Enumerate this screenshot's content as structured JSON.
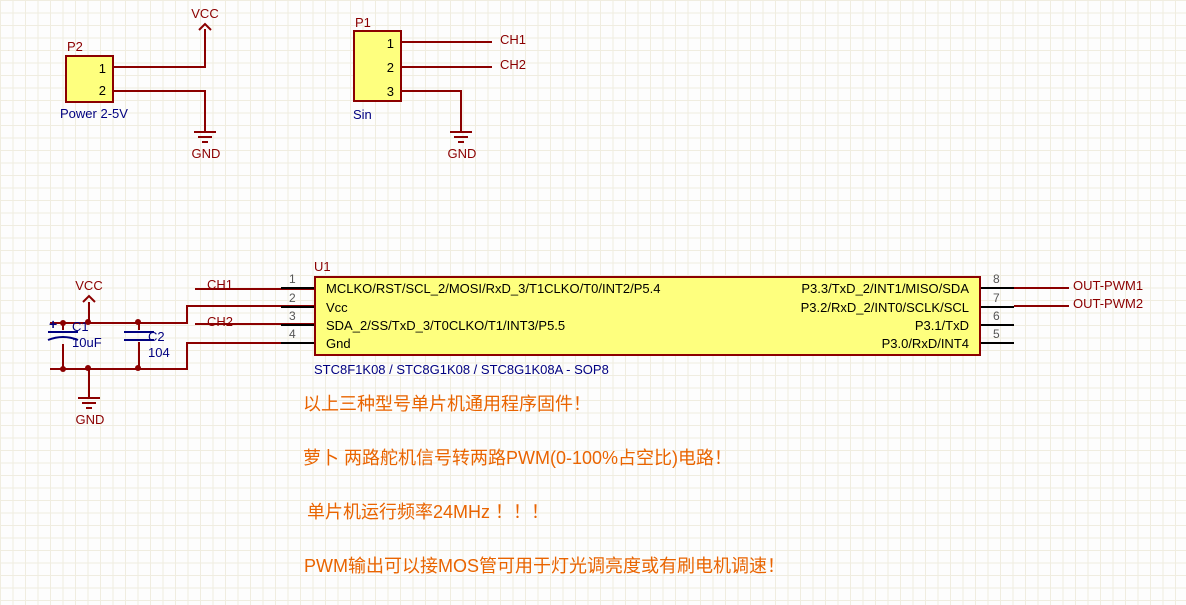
{
  "pwr": {
    "vcc": "VCC",
    "gnd": "GND"
  },
  "P2": {
    "ref": "P2",
    "pins": [
      "1",
      "2"
    ],
    "desc": "Power 2-5V"
  },
  "P1": {
    "ref": "P1",
    "pins": [
      "1",
      "2",
      "3"
    ],
    "desc": "Sin"
  },
  "nets": {
    "ch1": "CH1",
    "ch2": "CH2",
    "out1": "OUT-PWM1",
    "out2": "OUT-PWM2",
    "vcc_side": "VCC",
    "gnd_side": "GND"
  },
  "C1": {
    "ref": "C1",
    "val": "10uF"
  },
  "C2": {
    "ref": "C2",
    "val": "104"
  },
  "U1": {
    "ref": "U1",
    "left": {
      "1": "MCLKO/RST/SCL_2/MOSI/RxD_3/T1CLKO/T0/INT2/P5.4",
      "2": "Vcc",
      "3": "SDA_2/SS/TxD_3/T0CLKO/T1/INT3/P5.5",
      "4": "Gnd"
    },
    "right": {
      "8": "P3.3/TxD_2/INT1/MISO/SDA",
      "7": "P3.2/RxD_2/INT0/SCLK/SCL",
      "6": "P3.1/TxD",
      "5": "P3.0/RxD/INT4"
    },
    "part": "STC8F1K08 / STC8G1K08 / STC8G1K08A - SOP8"
  },
  "notes": [
    "以上三种型号单片机通用程序固件！",
    "萝卜 两路舵机信号转两路PWM(0-100%占空比)电路！",
    "单片机运行频率24MHz ！！！",
    "PWM输出可以接MOS管可用于灯光调亮度或有刷电机调速！"
  ],
  "chart_data": {
    "type": "schematic",
    "connectors": [
      {
        "ref": "P2",
        "pins": 2,
        "function": "Power 2-5V",
        "nets": {
          "1": "VCC",
          "2": "GND"
        }
      },
      {
        "ref": "P1",
        "pins": 3,
        "function": "Sin",
        "nets": {
          "1": "CH1",
          "2": "CH2",
          "3": "GND"
        }
      }
    ],
    "passives": [
      {
        "ref": "C1",
        "value": "10uF",
        "type": "polarized-capacitor",
        "nets": [
          "VCC",
          "GND"
        ]
      },
      {
        "ref": "C2",
        "value": "104",
        "type": "capacitor",
        "nets": [
          "VCC",
          "GND"
        ]
      }
    ],
    "ic": {
      "ref": "U1",
      "package": "SOP8",
      "compatible": [
        "STC8F1K08",
        "STC8G1K08",
        "STC8G1K08A"
      ],
      "pins": {
        "1": {
          "name": "MCLKO/RST/SCL_2/MOSI/RxD_3/T1CLKO/T0/INT2/P5.4",
          "net": "CH1"
        },
        "2": {
          "name": "Vcc",
          "net": "VCC"
        },
        "3": {
          "name": "SDA_2/SS/TxD_3/T0CLKO/T1/INT3/P5.5",
          "net": "CH2"
        },
        "4": {
          "name": "Gnd",
          "net": "GND"
        },
        "5": {
          "name": "P3.0/RxD/INT4",
          "net": ""
        },
        "6": {
          "name": "P3.1/TxD",
          "net": ""
        },
        "7": {
          "name": "P3.2/RxD_2/INT0/SCLK/SCL",
          "net": "OUT-PWM2"
        },
        "8": {
          "name": "P3.3/TxD_2/INT1/MISO/SDA",
          "net": "OUT-PWM1"
        }
      }
    }
  }
}
